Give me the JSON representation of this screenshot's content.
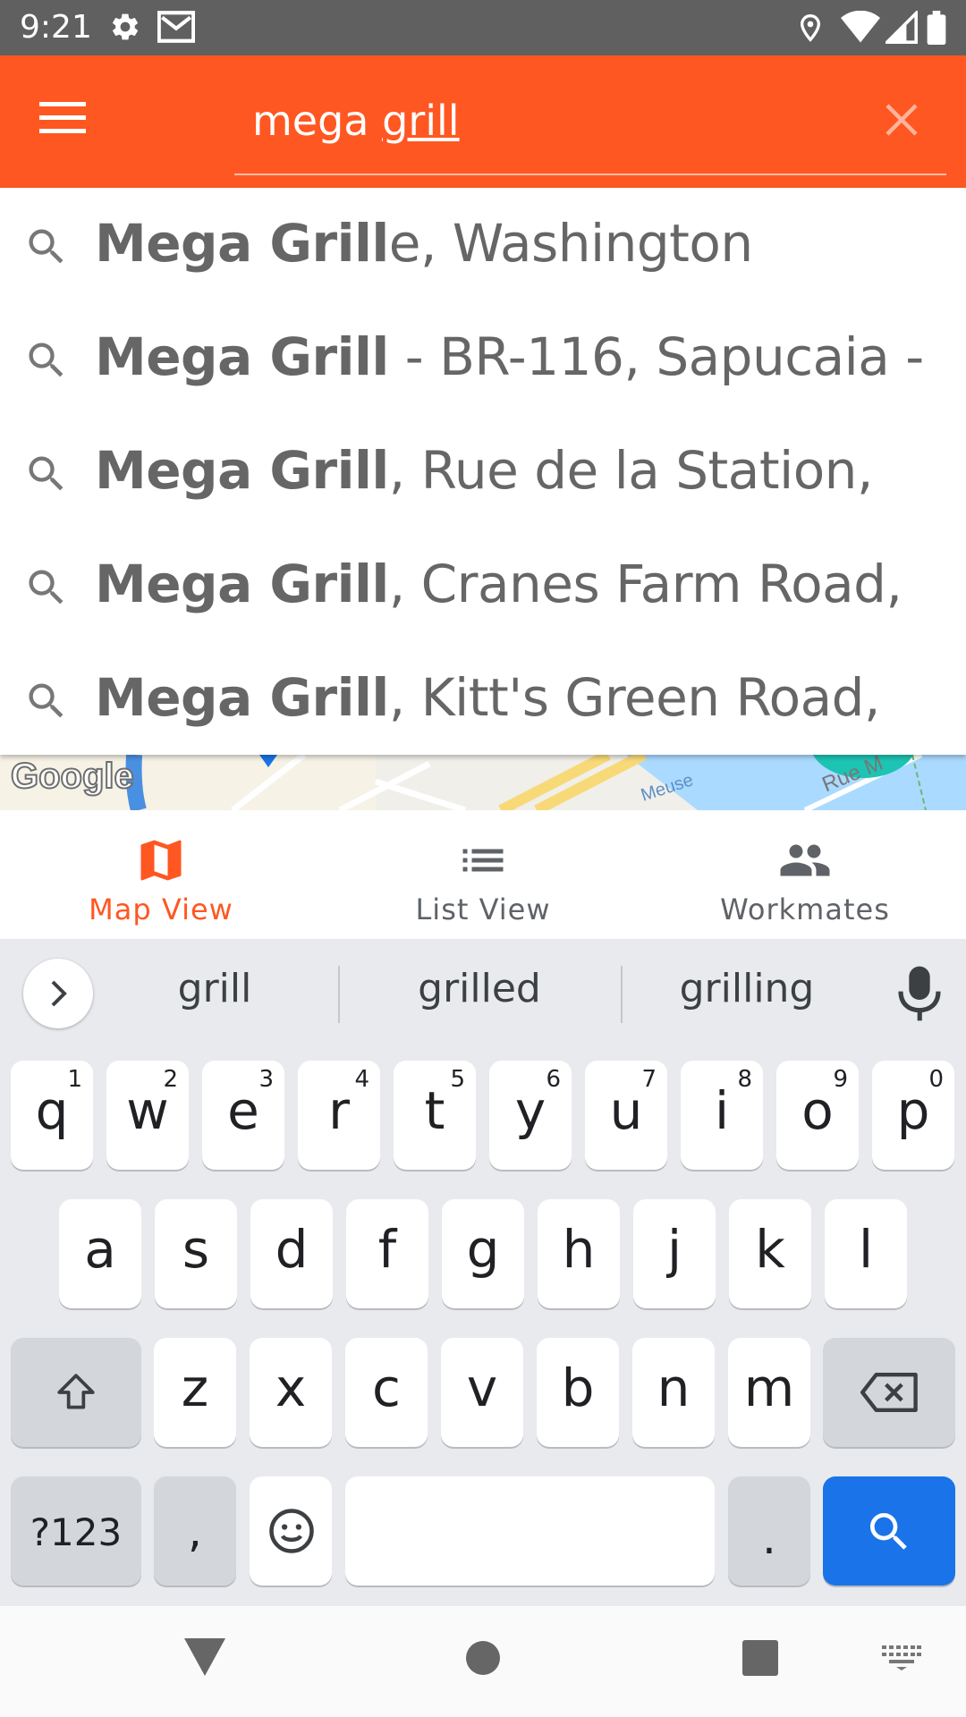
{
  "status_bar": {
    "time": "9:21",
    "icons": [
      "settings-icon",
      "gmail-icon",
      "location-icon",
      "wifi-icon",
      "signal-icon",
      "battery-icon"
    ]
  },
  "toolbar": {
    "menu_icon": "menu-icon",
    "search_value_prefix": "mega ",
    "search_value_underlined": "grill",
    "clear_icon": "close-icon",
    "background": "#ff5722"
  },
  "suggestions": [
    {
      "bold": "Mega Grill",
      "rest": "e, Washington"
    },
    {
      "bold": "Mega Grill",
      "rest": " - BR-116, Sapucaia -"
    },
    {
      "bold": "Mega Grill",
      "rest": ", Rue de la Station,"
    },
    {
      "bold": "Mega Grill",
      "rest": ", Cranes Farm Road,"
    },
    {
      "bold": "Mega Grill",
      "rest": ", Kitt's Green Road,"
    }
  ],
  "map": {
    "logo": "Google",
    "labels": [
      "Meuse",
      "Rue M"
    ]
  },
  "bottom_nav": {
    "items": [
      {
        "label": "Map View",
        "icon": "map-icon",
        "active": true
      },
      {
        "label": "List View",
        "icon": "list-icon",
        "active": false
      },
      {
        "label": "Workmates",
        "icon": "people-icon",
        "active": false
      }
    ],
    "active_color": "#ff5722",
    "inactive_color": "#5f6368"
  },
  "keyboard": {
    "suggestions": [
      "grill",
      "grilled",
      "grilling"
    ],
    "row1": [
      {
        "c": "q",
        "n": "1"
      },
      {
        "c": "w",
        "n": "2"
      },
      {
        "c": "e",
        "n": "3"
      },
      {
        "c": "r",
        "n": "4"
      },
      {
        "c": "t",
        "n": "5"
      },
      {
        "c": "y",
        "n": "6"
      },
      {
        "c": "u",
        "n": "7"
      },
      {
        "c": "i",
        "n": "8"
      },
      {
        "c": "o",
        "n": "9"
      },
      {
        "c": "p",
        "n": "0"
      }
    ],
    "row2": [
      "a",
      "s",
      "d",
      "f",
      "g",
      "h",
      "j",
      "k",
      "l"
    ],
    "row3": [
      "z",
      "x",
      "c",
      "v",
      "b",
      "n",
      "m"
    ],
    "symbols_label": "?123",
    "comma_label": ",",
    "period_label": ".",
    "action_color": "#1a73e8"
  }
}
